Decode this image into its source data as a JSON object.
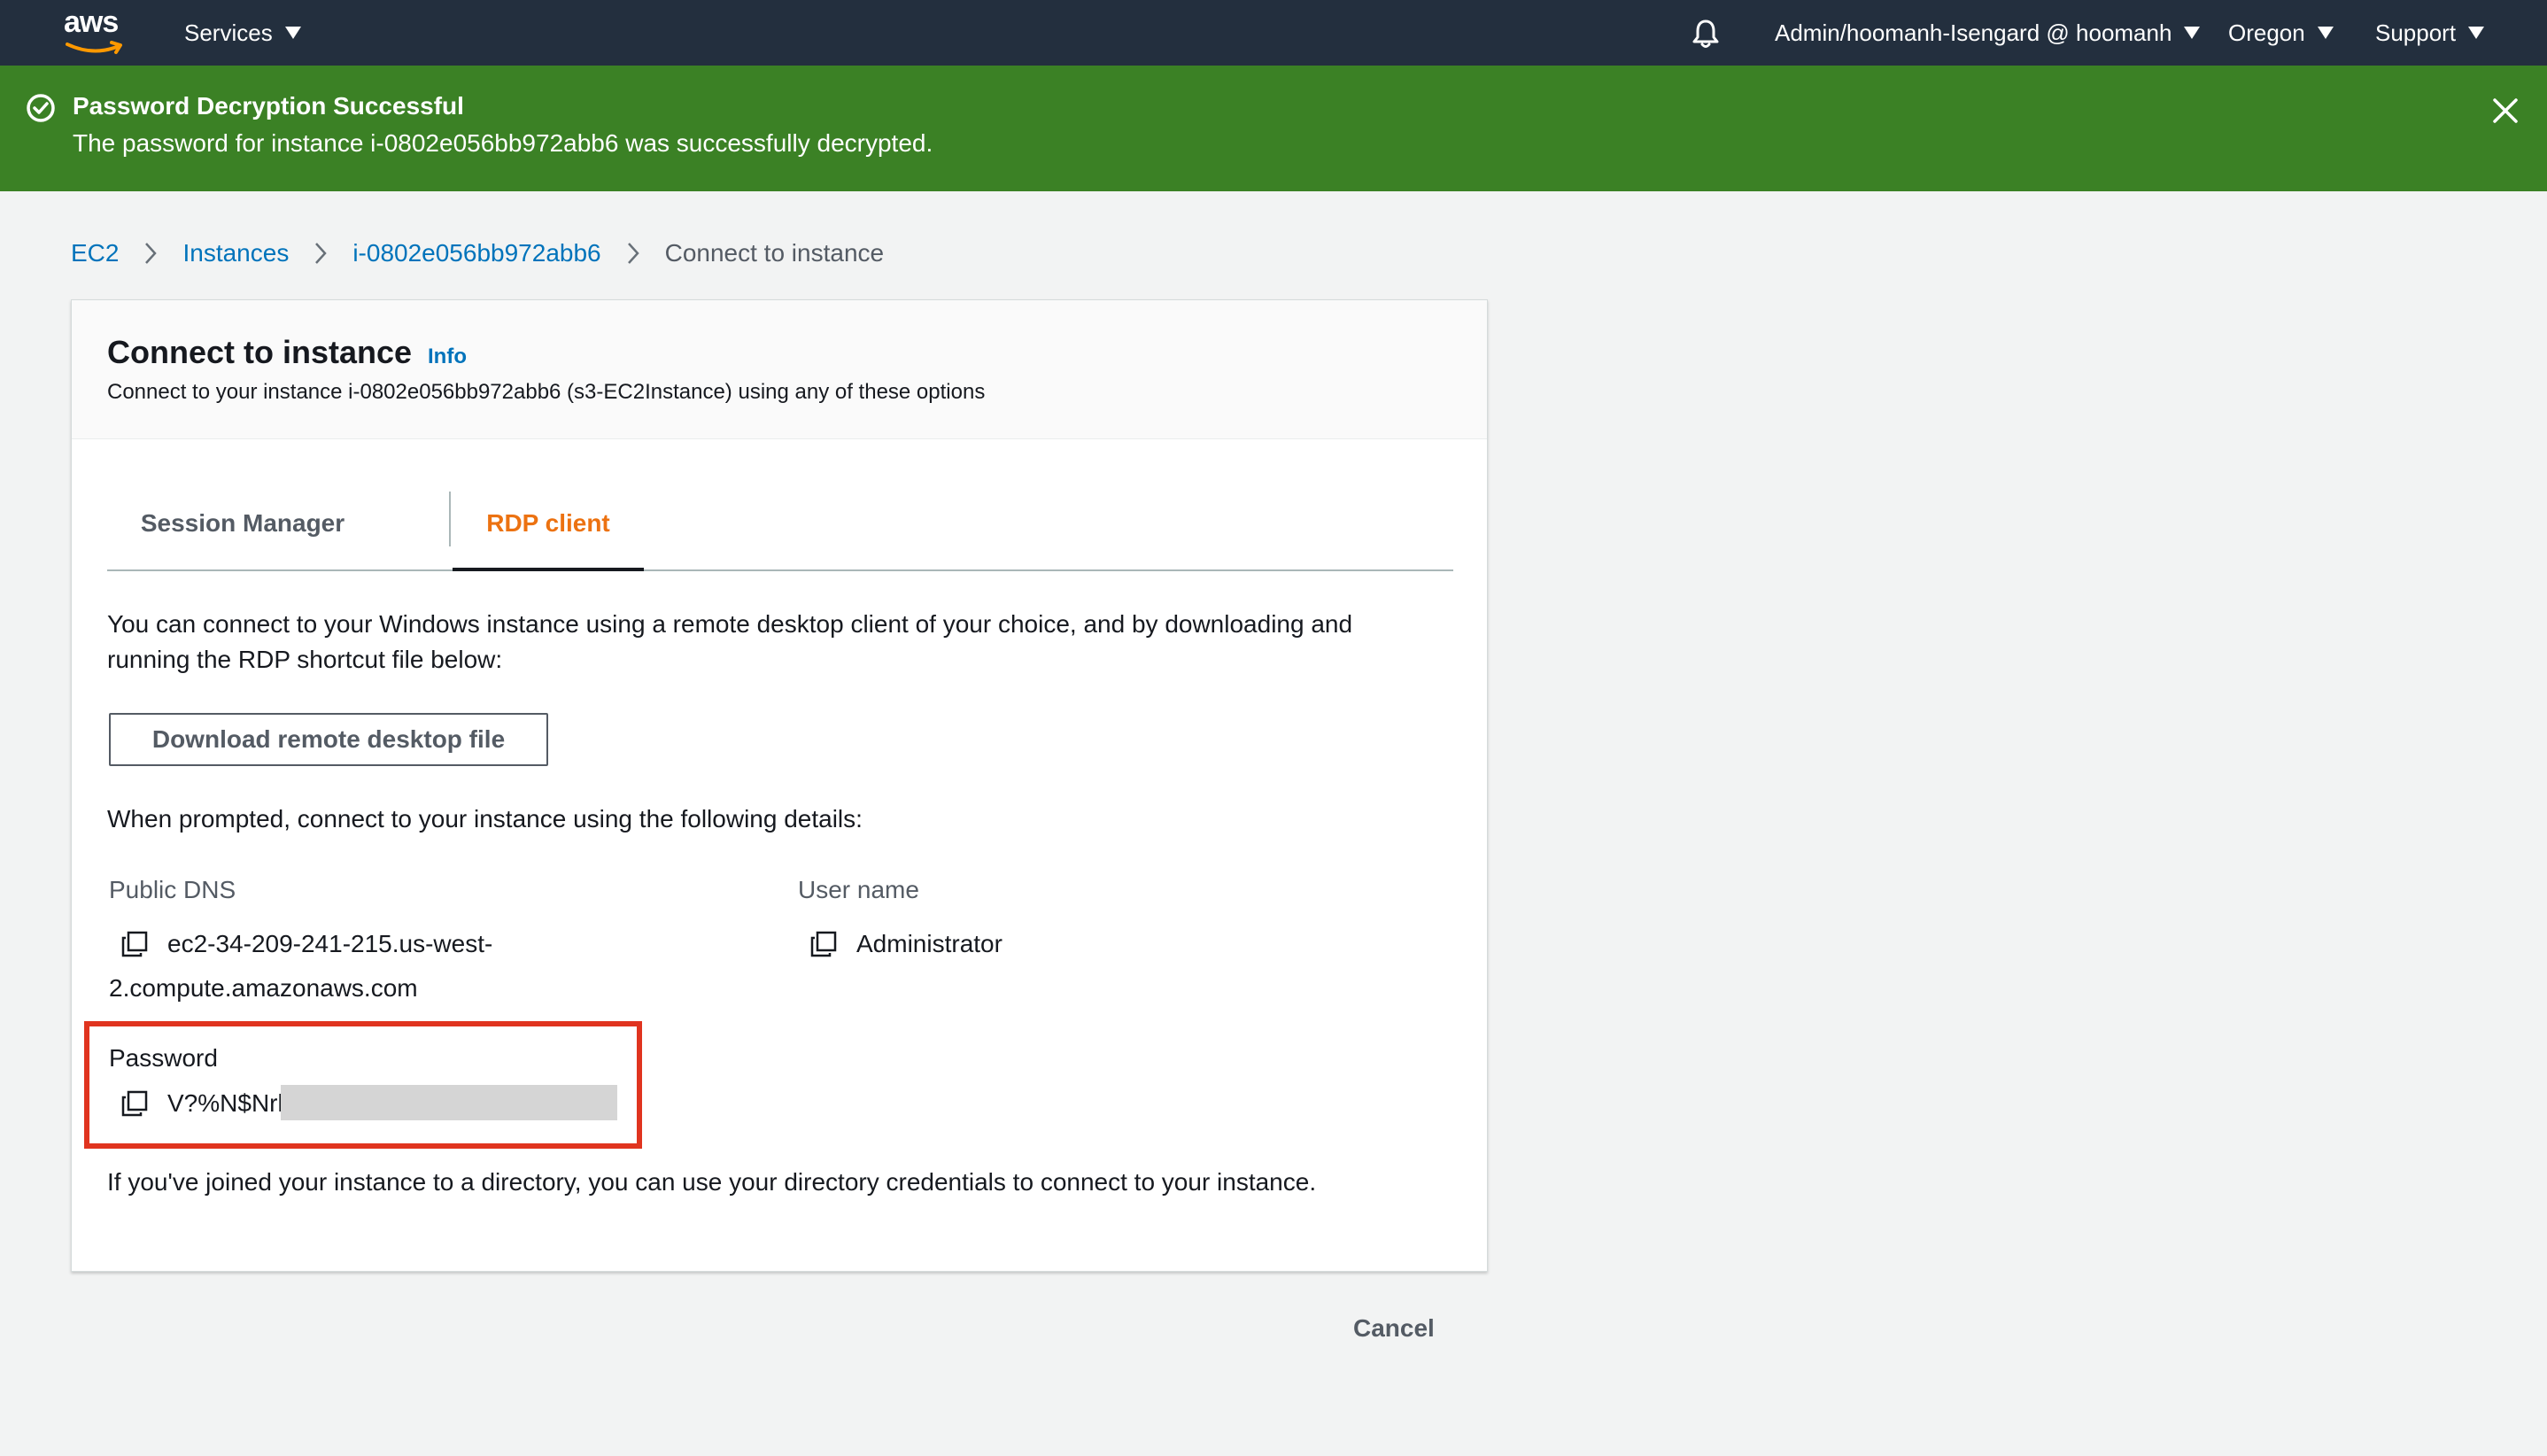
{
  "nav": {
    "logo_text": "aws",
    "services": "Services",
    "account": "Admin/hoomanh-Isengard @ hoomanh",
    "region": "Oregon",
    "support": "Support"
  },
  "flash": {
    "title": "Password Decryption Successful",
    "message": "The password for instance i-0802e056bb972abb6 was successfully decrypted.",
    "color": "#3b8125"
  },
  "breadcrumb": {
    "items": [
      "EC2",
      "Instances",
      "i-0802e056bb972abb6"
    ],
    "current": "Connect to instance"
  },
  "panel": {
    "title": "Connect to instance",
    "info": "Info",
    "description": "Connect to your instance i-0802e056bb972abb6 (s3-EC2Instance) using any of these options"
  },
  "tabs": {
    "session_manager": "Session Manager",
    "rdp_client": "RDP client",
    "active": "RDP client"
  },
  "rdp": {
    "intro_line1": "You can connect to your Windows instance using a remote desktop client of your choice, and by downloading and",
    "intro_line2": "running the RDP shortcut file below:",
    "download_button": "Download remote desktop file",
    "prompt": "When prompted, connect to your instance using the following details:",
    "public_dns_label": "Public DNS",
    "public_dns_line1": "ec2-34-209-241-215.us-west-",
    "public_dns_line2": "2.compute.amazonaws.com",
    "username_label": "User name",
    "username": "Administrator",
    "password_label": "Password",
    "password_visible": "V?%N$Nrl",
    "directory_note": "If you've joined your instance to a directory, you can use your directory credentials to connect to your instance."
  },
  "footer": {
    "cancel": "Cancel"
  },
  "colors": {
    "nav_bg": "#232f3e",
    "link": "#0073bb",
    "active_tab": "#ec7211",
    "highlight": "#e0341f"
  }
}
